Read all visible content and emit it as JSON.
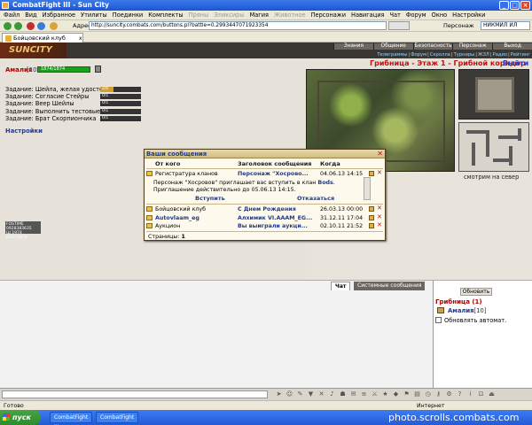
{
  "window": {
    "title": "CombatFight III - Sun City",
    "buttons": {
      "min": "_",
      "max": "□",
      "close": "×"
    }
  },
  "menu": [
    "Файл",
    "Вид",
    "Избранное",
    "Утилиты",
    "Поединки",
    "Комплекты",
    "Пряны",
    "Эликсиры",
    "Магия",
    "Животное",
    "Персонажи",
    "Навигация",
    "Чат",
    "Форум",
    "Окно",
    "Настройки"
  ],
  "menu_dim": [
    6,
    7,
    9
  ],
  "toolbar": {
    "address_label": "Адрес",
    "address_value": "http://suncity.combats.com/buttons.pl?battle=0.2993447071923354",
    "character_label": "Персонаж",
    "character_value": "НИКМИЛ ИЛ"
  },
  "tab": {
    "label": "Бойцовский клуб",
    "close": "x"
  },
  "game": {
    "logo": "SUNCITY",
    "nav_top": [
      "Знания",
      "Общение",
      "Безопасность",
      "Персонаж",
      "Выход"
    ],
    "nav_bottom": [
      "Телеграммы",
      "Форум",
      "Скролла",
      "Турниры",
      "ЖЗЛ",
      "Радио",
      "Рейтинг"
    ]
  },
  "character": {
    "name": "Амалия",
    "level": "[10]",
    "hp": "1874/1874",
    "tasks": [
      {
        "label": "Задание: Шейла, желая удостов...",
        "value": "2/6",
        "progress": 0.33
      },
      {
        "label": "Задание:             Согласие Стейры",
        "value": "0/1",
        "progress": 0
      },
      {
        "label": "Задание:                    Веер Шейлы",
        "value": "0/1",
        "progress": 0
      },
      {
        "label": "Задание: Выполнить тестовые з...",
        "value": "0/1",
        "progress": 0
      },
      {
        "label": "Задание:          Брат Скорпиончика",
        "value": "0/1",
        "progress": 0
      }
    ],
    "settings": "Настройки"
  },
  "location": {
    "title": "Грибница - Этаж 1 - Грибной коридор",
    "exit": "Выйти",
    "map_caption": "смотрим на север"
  },
  "messages": {
    "title": "Ваши сообщения",
    "close": "✕",
    "headers": {
      "from": "От кого",
      "subject": "Заголовок сообщения",
      "when": "Когда"
    },
    "open_message": {
      "from": "Регистратура кланов",
      "subject": "Персонаж \"Хосрово...",
      "when": "04.06.13 14:15",
      "body_1": "Персонаж \"Хосровов\" приглашает вас вступить в клан ",
      "body_clan": "Bods",
      "body_2": ". Приглашение действительно до 05.06.13 14:15.",
      "join": "Вступить",
      "decline": "Отказаться"
    },
    "rows": [
      {
        "from": "Бойцовский клуб",
        "subject": "С Днем Рождения",
        "when": "26.03.13 00:00"
      },
      {
        "from": "Autovlaam_eg",
        "subject": "Алхимик VI.AAAM_EG...",
        "when": "31.12.11 17:04"
      },
      {
        "from": "Аукцион",
        "subject": "Вы выиграли аукци...",
        "when": "02.10.11 21:52"
      }
    ],
    "pages_label": "Страницы:",
    "pages_value": "1"
  },
  "chat": {
    "tab_chat": "Чат",
    "tab_system": "Системные сообщения",
    "refresh": "Обновить",
    "room": "Грибница (1)",
    "user": "Амалия",
    "user_level": "[10]",
    "auto_refresh": "Обновлять автомат."
  },
  "status": {
    "left": "Готово",
    "right": "Интернет"
  },
  "stats_widget": [
    "FOSTIME 0928383635",
    "Щ 1974",
    "ERGI 1874"
  ],
  "taskbar": {
    "start": "пуск",
    "tasks": [
      "CombatFight III",
      "CombatFight"
    ],
    "watermark": "photo.scrolls.combats.com"
  }
}
